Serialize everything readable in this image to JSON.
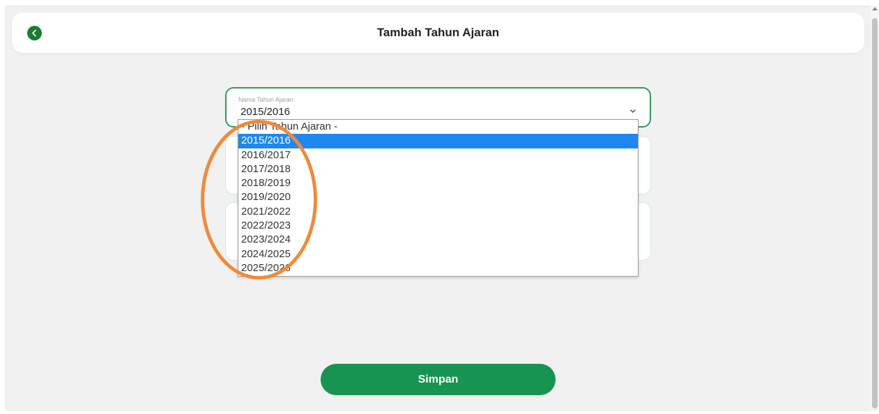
{
  "header": {
    "title": "Tambah Tahun Ajaran",
    "back_icon": "chevron-left-icon"
  },
  "form": {
    "year_field": {
      "label": "Nama Tahun Ajaran",
      "value": "2015/2016"
    }
  },
  "dropdown": {
    "options": [
      "- Pilih Tahun Ajaran -",
      "2015/2016",
      "2016/2017",
      "2017/2018",
      "2018/2019",
      "2019/2020",
      "2021/2022",
      "2022/2023",
      "2023/2024",
      "2024/2025",
      "2025/2026"
    ],
    "selected": "2015/2016"
  },
  "actions": {
    "save_label": "Simpan"
  },
  "colors": {
    "brand_green": "#179352",
    "selection_blue": "#1e88f0",
    "annotation_orange": "#f08a3a"
  }
}
